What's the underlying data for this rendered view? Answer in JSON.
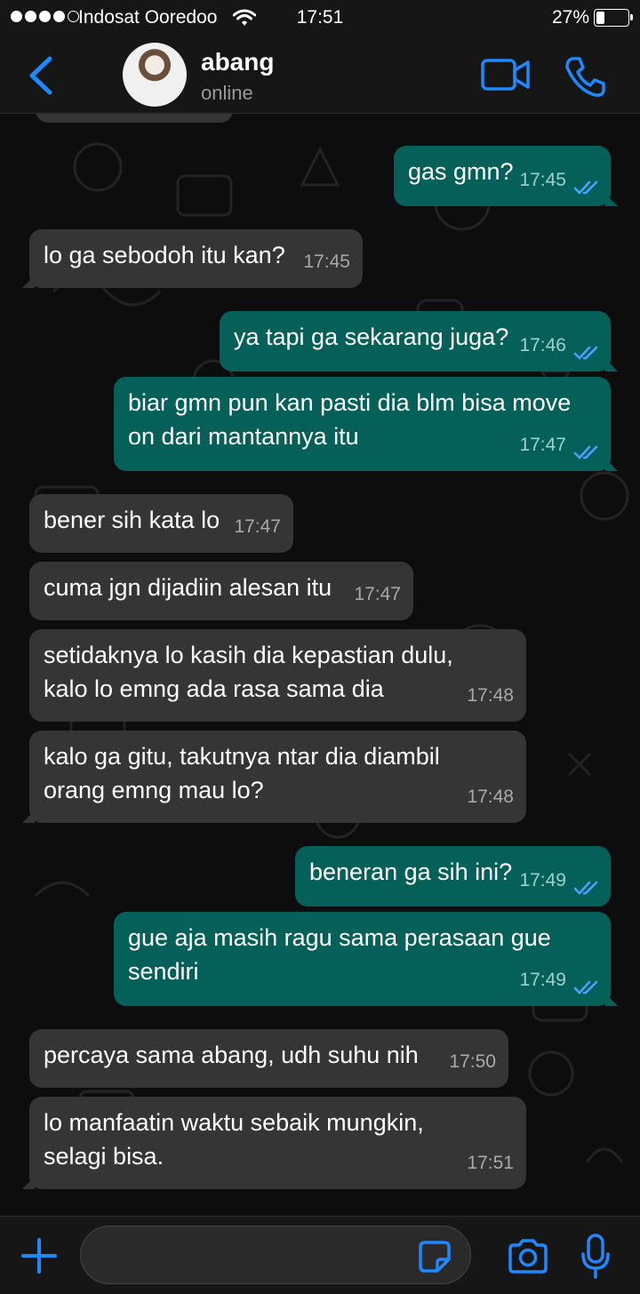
{
  "status_bar": {
    "carrier": "Indosat Ooredoo",
    "time": "17:51",
    "battery": "27%"
  },
  "header": {
    "contact_name": "abang",
    "contact_status": "online"
  },
  "messages": [
    {
      "dir": "out",
      "text": "gas gmn?",
      "time": "17:45"
    },
    {
      "dir": "in",
      "text": "lo ga sebodoh itu kan?",
      "time": "17:45"
    },
    {
      "dir": "out",
      "text": "ya tapi ga sekarang juga?",
      "time": "17:46"
    },
    {
      "dir": "out",
      "text": "biar gmn pun kan pasti dia blm bisa move on dari mantannya itu",
      "time": "17:47"
    },
    {
      "dir": "in",
      "text": "bener sih kata lo",
      "time": "17:47"
    },
    {
      "dir": "in",
      "text": "cuma jgn dijadiin alesan itu",
      "time": "17:47"
    },
    {
      "dir": "in",
      "text": "setidaknya lo kasih dia kepastian dulu, kalo lo emng ada rasa sama dia",
      "time": "17:48"
    },
    {
      "dir": "in",
      "text": "kalo ga gitu, takutnya ntar dia diambil orang emng mau lo?",
      "time": "17:48"
    },
    {
      "dir": "out",
      "text": "beneran ga sih ini?",
      "time": "17:49"
    },
    {
      "dir": "out",
      "text": "gue aja masih ragu sama perasaan gue sendiri",
      "time": "17:49"
    },
    {
      "dir": "in",
      "text": "percaya sama abang, udh suhu nih",
      "time": "17:50"
    },
    {
      "dir": "in",
      "text": "lo manfaatin waktu sebaik mungkin, selagi bisa.",
      "time": "17:51"
    }
  ],
  "colors": {
    "accent": "#1e88ff",
    "incoming_bubble": "#353535",
    "outgoing_bubble": "#05605a",
    "read_ticks": "#4aa3ff"
  },
  "icons": [
    "back-icon",
    "video-call-icon",
    "voice-call-icon",
    "plus-icon",
    "sticker-icon",
    "camera-icon",
    "mic-icon"
  ]
}
